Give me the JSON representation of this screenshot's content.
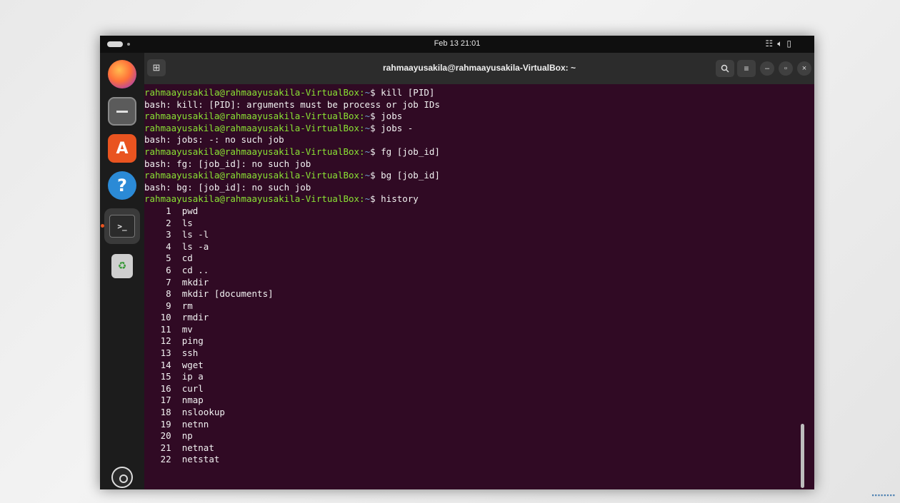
{
  "topbar": {
    "clock": "Feb 13  21:01",
    "tray_icons": [
      "network-icon",
      "volume-icon",
      "battery-icon"
    ]
  },
  "dock": {
    "items": [
      "firefox-icon",
      "files-icon",
      "app-center-icon",
      "help-icon",
      "terminal-icon",
      "trash-icon",
      "show-apps-icon"
    ],
    "help_glyph": "?",
    "app_center_glyph": "A",
    "terminal_glyph": ">_"
  },
  "window": {
    "title": "rahmaayusakila@rahmaayusakila-VirtualBox: ~",
    "buttons": {
      "search": "🔍",
      "menu": "≡",
      "minimize": "–",
      "maximize": "▫",
      "close": "×"
    },
    "new_tab_glyph": "⊞"
  },
  "terminal": {
    "prompt_user": "rahmaayusakila@rahmaayusakila-VirtualBox:",
    "prompt_path": "~",
    "prompt_symbol": "$",
    "lines": [
      {
        "type": "cmd",
        "cmd": "kill [PID]"
      },
      {
        "type": "out",
        "text": "bash: kill: [PID]: arguments must be process or job IDs"
      },
      {
        "type": "cmd",
        "cmd": "jobs"
      },
      {
        "type": "cmd",
        "cmd": "jobs -"
      },
      {
        "type": "out",
        "text": "bash: jobs: -: no such job"
      },
      {
        "type": "cmd",
        "cmd": "fg [job_id]"
      },
      {
        "type": "out",
        "text": "bash: fg: [job_id]: no such job"
      },
      {
        "type": "cmd",
        "cmd": "bg [job_id]"
      },
      {
        "type": "out",
        "text": "bash: bg: [job_id]: no such job"
      },
      {
        "type": "cmd",
        "cmd": "history"
      }
    ],
    "history": [
      {
        "n": "1",
        "cmd": "pwd"
      },
      {
        "n": "2",
        "cmd": "ls"
      },
      {
        "n": "3",
        "cmd": "ls -l"
      },
      {
        "n": "4",
        "cmd": "ls -a"
      },
      {
        "n": "5",
        "cmd": "cd"
      },
      {
        "n": "6",
        "cmd": "cd .."
      },
      {
        "n": "7",
        "cmd": "mkdir"
      },
      {
        "n": "8",
        "cmd": "mkdir [documents]"
      },
      {
        "n": "9",
        "cmd": "rm"
      },
      {
        "n": "10",
        "cmd": "rmdir"
      },
      {
        "n": "11",
        "cmd": "mv"
      },
      {
        "n": "12",
        "cmd": "ping"
      },
      {
        "n": "13",
        "cmd": "ssh"
      },
      {
        "n": "14",
        "cmd": "wget"
      },
      {
        "n": "15",
        "cmd": "ip a"
      },
      {
        "n": "16",
        "cmd": "curl"
      },
      {
        "n": "17",
        "cmd": "nmap"
      },
      {
        "n": "18",
        "cmd": "nslookup"
      },
      {
        "n": "19",
        "cmd": "netnn"
      },
      {
        "n": "20",
        "cmd": "np"
      },
      {
        "n": "21",
        "cmd": "netnat"
      },
      {
        "n": "22",
        "cmd": "netstat"
      }
    ]
  },
  "colors": {
    "terminal_bg": "#300a24",
    "prompt_user": "#8ae234",
    "prompt_path": "#729fcf",
    "accent": "#e95420"
  }
}
